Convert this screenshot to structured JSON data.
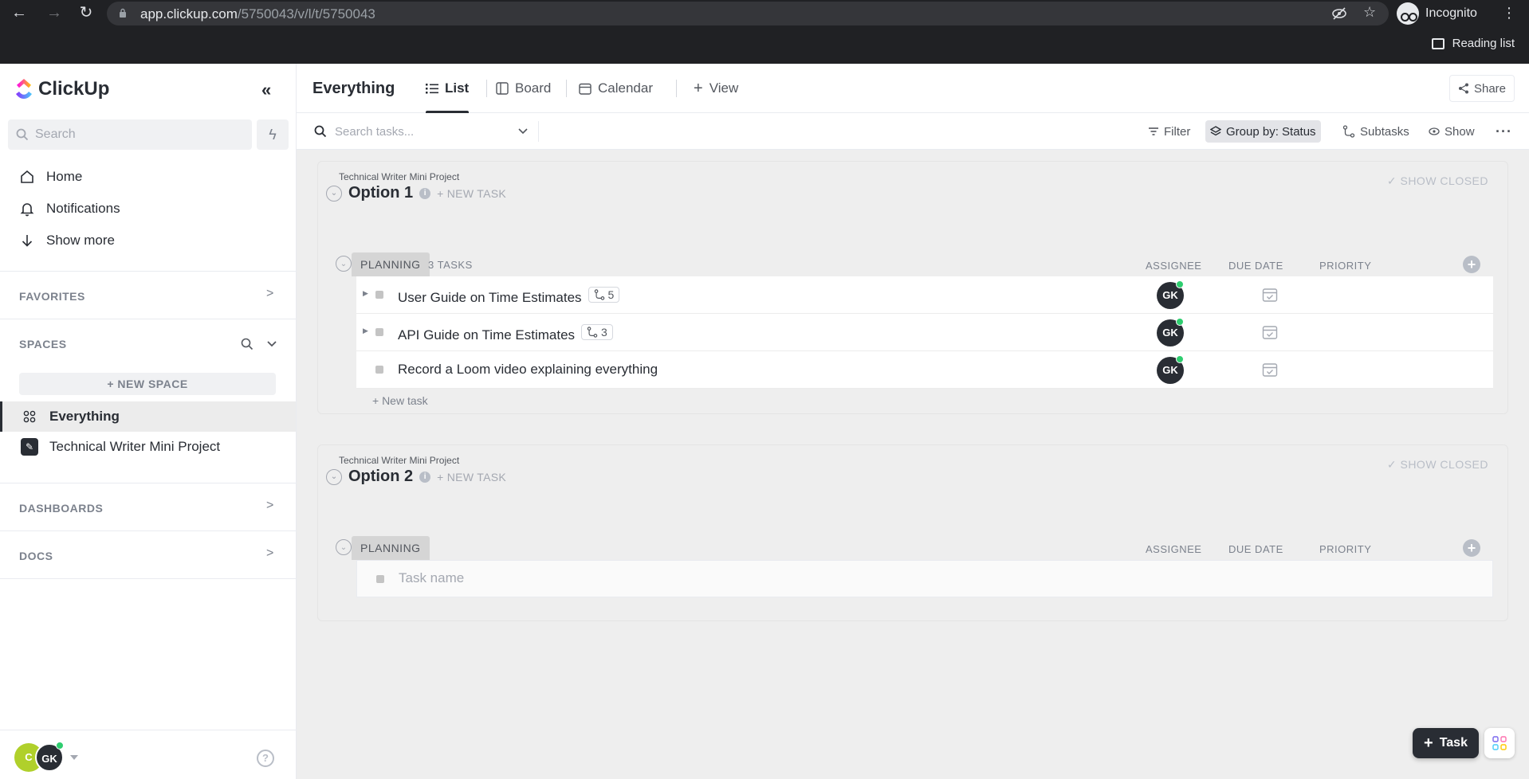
{
  "browser": {
    "url_host": "app.clickup.com",
    "url_path": "/5750043/v/l/t/5750043",
    "profile_label": "Incognito",
    "reading_list_label": "Reading list"
  },
  "sidebar": {
    "brand": "ClickUp",
    "search_placeholder": "Search",
    "nav": [
      {
        "label": "Home",
        "icon": "home-icon"
      },
      {
        "label": "Notifications",
        "icon": "bell-icon"
      },
      {
        "label": "Show more",
        "icon": "arrow-down-icon"
      }
    ],
    "favorites_title": "FAVORITES",
    "spaces_title": "SPACES",
    "new_space_label": "+ NEW SPACE",
    "spaces": [
      {
        "label": "Everything",
        "icon": "grid-icon",
        "active": true
      },
      {
        "label": "Technical Writer Mini Project",
        "icon": "pen-icon",
        "active": false
      }
    ],
    "dashboards_title": "DASHBOARDS",
    "docs_title": "DOCS",
    "user_initial": "C",
    "user_initials": "GK",
    "help_glyph": "?"
  },
  "header": {
    "title": "Everything",
    "tabs": [
      {
        "label": "List",
        "active": true
      },
      {
        "label": "Board",
        "active": false
      },
      {
        "label": "Calendar",
        "active": false
      }
    ],
    "add_view_label": "View",
    "share_label": "Share"
  },
  "toolbar": {
    "search_placeholder": "Search tasks...",
    "filter_label": "Filter",
    "group_by_label": "Group by: Status",
    "subtasks_label": "Subtasks",
    "show_label": "Show"
  },
  "lists": [
    {
      "project": "Technical Writer Mini Project",
      "title": "Option 1",
      "new_task_label": "+ NEW TASK",
      "show_closed_label": "✓ SHOW CLOSED",
      "group": {
        "status": "PLANNING",
        "count_label": "3 TASKS",
        "columns": [
          "ASSIGNEE",
          "DUE DATE",
          "PRIORITY"
        ],
        "tasks": [
          {
            "name": "User Guide on Time Estimates",
            "subtasks": "5",
            "assignee": "GK"
          },
          {
            "name": "API Guide on Time Estimates",
            "subtasks": "3",
            "assignee": "GK"
          },
          {
            "name": "Record a Loom video explaining everything",
            "subtasks": "",
            "assignee": "GK"
          }
        ],
        "new_task_label": "+ New task"
      }
    },
    {
      "project": "Technical Writer Mini Project",
      "title": "Option 2",
      "new_task_label": "+ NEW TASK",
      "show_closed_label": "✓ SHOW CLOSED",
      "group": {
        "status": "PLANNING",
        "columns": [
          "ASSIGNEE",
          "DUE DATE",
          "PRIORITY"
        ],
        "task_name_placeholder": "Task name"
      }
    }
  ],
  "fab": {
    "task_label": "Task"
  },
  "colors": {
    "accent_dark": "#292d34",
    "online": "#2ecd6f",
    "user_c": "#b0d02b"
  }
}
